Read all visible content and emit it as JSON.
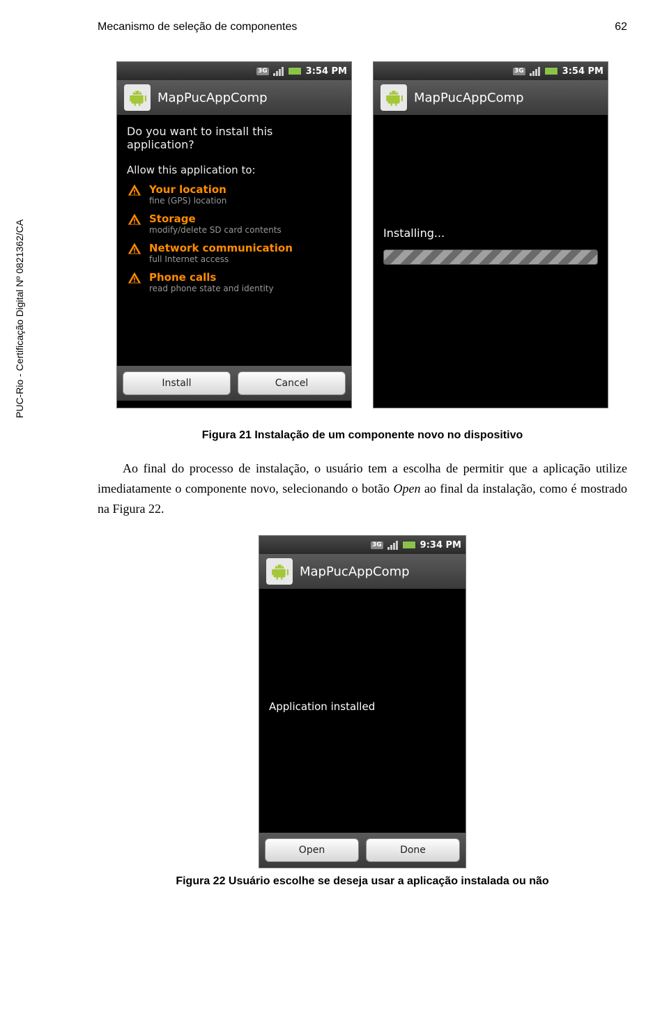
{
  "header": {
    "title": "Mecanismo de seleção de componentes",
    "page": "62"
  },
  "sidetext": "PUC-Rio - Certificação Digital Nº 0821362/CA",
  "status": {
    "time1": "3:54 PM",
    "time2": "3:54 PM",
    "time3": "9:34 PM",
    "net": "3G"
  },
  "app": {
    "name": "MapPucAppComp"
  },
  "screen1": {
    "question": "Do you want to install this application?",
    "allow": "Allow this application to:",
    "perms": [
      {
        "title": "Your location",
        "sub": "fine (GPS) location"
      },
      {
        "title": "Storage",
        "sub": "modify/delete SD card contents"
      },
      {
        "title": "Network communication",
        "sub": "full Internet access"
      },
      {
        "title": "Phone calls",
        "sub": "read phone state and identity"
      }
    ],
    "install": "Install",
    "cancel": "Cancel"
  },
  "screen2": {
    "installing": "Installing..."
  },
  "caption1": "Figura 21 Instalação de um componente novo no dispositivo",
  "paragraph": {
    "p1a": "Ao final do processo de instalação, o usuário tem a escolha de permitir que a aplicação utilize imediatamente o componente novo, selecionando o botão ",
    "open": "Open",
    "p1b": " ao final da instalação, como é mostrado na ",
    "figref": "Figura 22",
    "p1c": "."
  },
  "screen3": {
    "installed": "Application installed",
    "open": "Open",
    "done": "Done"
  },
  "caption2": "Figura 22 Usuário escolhe se deseja usar a aplicação instalada ou não"
}
